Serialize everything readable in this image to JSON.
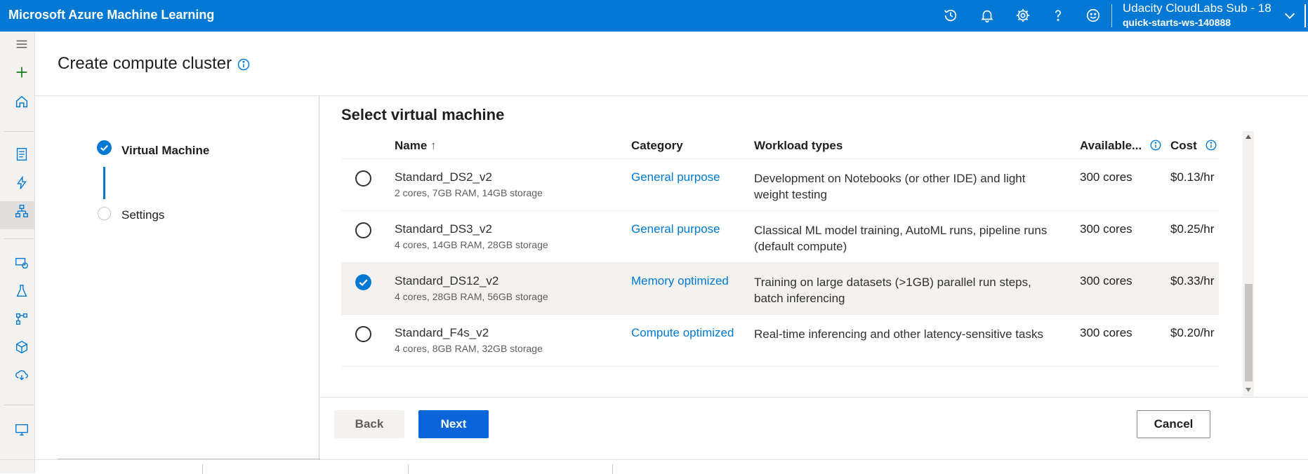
{
  "app": {
    "title": "Microsoft Azure Machine Learning",
    "account_name": "Udacity CloudLabs Sub - 18",
    "workspace": "quick-starts-ws-140888",
    "header_icons": [
      "history-icon",
      "bell-icon",
      "gear-icon",
      "help-icon",
      "smiley-icon"
    ]
  },
  "page": {
    "title": "Create compute cluster"
  },
  "steps": [
    {
      "label": "Virtual Machine",
      "state": "completed"
    },
    {
      "label": "Settings",
      "state": "pending"
    }
  ],
  "section": {
    "title": "Select virtual machine"
  },
  "table": {
    "columns": {
      "name": "Name",
      "sort_arrow": "↑",
      "category": "Category",
      "workload": "Workload types",
      "available": "Available...",
      "cost": "Cost"
    },
    "rows": [
      {
        "name": "Standard_DS2_v2",
        "spec": "2 cores, 7GB RAM, 14GB storage",
        "category": "General purpose",
        "workload": "Development on Notebooks (or other IDE) and light weight testing",
        "available": "300 cores",
        "cost": "$0.13/hr",
        "selected": false
      },
      {
        "name": "Standard_DS3_v2",
        "spec": "4 cores, 14GB RAM, 28GB storage",
        "category": "General purpose",
        "workload": "Classical ML model training, AutoML runs, pipeline runs (default compute)",
        "available": "300 cores",
        "cost": "$0.25/hr",
        "selected": false
      },
      {
        "name": "Standard_DS12_v2",
        "spec": "4 cores, 28GB RAM, 56GB storage",
        "category": "Memory optimized",
        "workload": "Training on large datasets (>1GB) parallel run steps, batch inferencing",
        "available": "300 cores",
        "cost": "$0.33/hr",
        "selected": true
      },
      {
        "name": "Standard_F4s_v2",
        "spec": "4 cores, 8GB RAM, 32GB storage",
        "category": "Compute optimized",
        "workload": "Real-time inferencing and other latency-sensitive tasks",
        "available": "300 cores",
        "cost": "$0.20/hr",
        "selected": false
      }
    ]
  },
  "buttons": {
    "back": "Back",
    "next": "Next",
    "cancel": "Cancel"
  },
  "colors": {
    "brand": "#0078d4",
    "primary_button": "#0a66d8"
  }
}
